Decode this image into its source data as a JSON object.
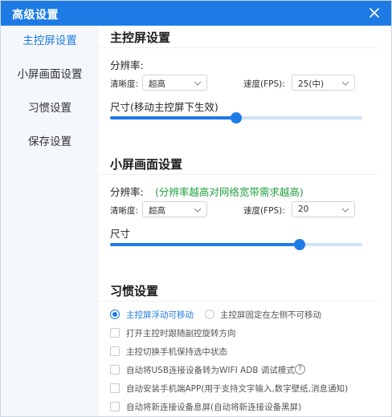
{
  "window": {
    "title": "高级设置",
    "accent_color": "#1e7be6"
  },
  "sidebar": {
    "items": [
      {
        "label": "主控屏设置",
        "active": true
      },
      {
        "label": "小屏画面设置",
        "active": false
      },
      {
        "label": "习惯设置",
        "active": false
      },
      {
        "label": "保存设置",
        "active": false
      }
    ]
  },
  "main_screen": {
    "title": "主控屏设置",
    "resolution_label": "分辨率:",
    "clarity_label": "清晰度:",
    "clarity_value": "超高",
    "fps_label": "速度(FPS):",
    "fps_value": "25(中)",
    "size_label": "尺寸(移动主控屏下生效)",
    "size_fraction": 0.5
  },
  "small_screen": {
    "title": "小屏画面设置",
    "resolution_label": "分辨率:",
    "resolution_hint": "(分辨率越高对网络宽带需求越高)",
    "clarity_label": "清晰度:",
    "clarity_value": "超高",
    "fps_label": "速度(FPS):",
    "fps_value": "20",
    "size_label": "尺寸",
    "size_fraction": 0.75
  },
  "habits": {
    "title": "习惯设置",
    "radio_options": [
      {
        "label": "主控屏浮动可移动",
        "checked": true
      },
      {
        "label": "主控屏固定在左侧不可移动",
        "checked": false
      }
    ],
    "checkboxes": [
      {
        "label": "打开主控时跟随副控旋转方向",
        "checked": false
      },
      {
        "label": "主控切换手机保持选中状态",
        "checked": false
      },
      {
        "label": "自动将USB连接设备转为WIFI ADB 调试模式",
        "checked": false,
        "help_icon": "question-circle-icon"
      },
      {
        "label": "自动安装手机端APP(用于支持文字输入,数字壁纸,消息通知)",
        "checked": false
      },
      {
        "label": "自动将新连接设备息屏(自动将新连接设备黑屏)",
        "checked": false
      }
    ]
  }
}
